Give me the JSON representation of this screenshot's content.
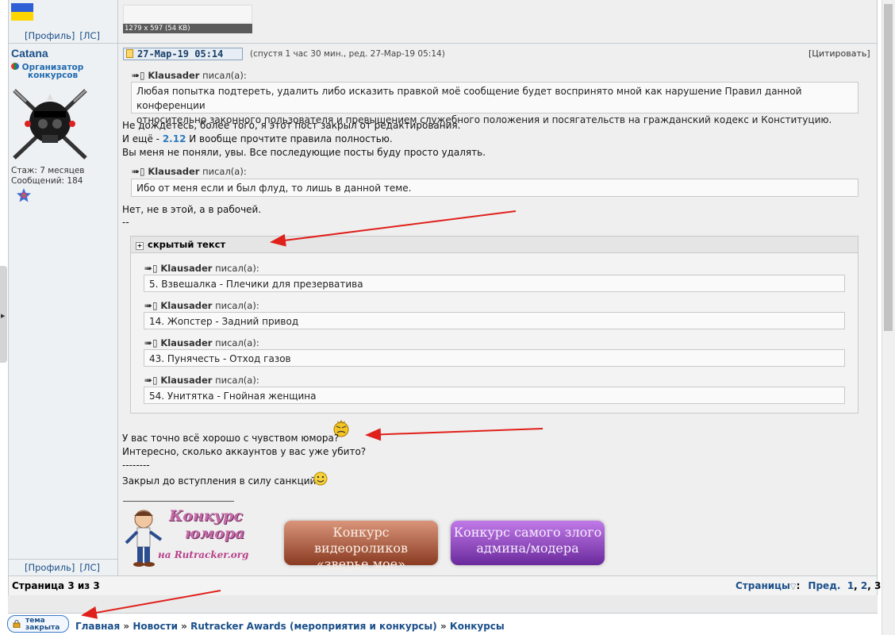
{
  "profile_links": {
    "profile": "[Профиль]",
    "pm": "[ЛС]"
  },
  "user": {
    "nick": "Catana",
    "rank_line1": "Организатор",
    "rank_line2": "конкурсов",
    "tenure": "Стаж: 7 месяцев",
    "posts": "Сообщений: 184"
  },
  "image_thumb": {
    "caption": "1279 x 597 (54 KB)"
  },
  "post": {
    "date": "27-Мар-19 05:14",
    "edited": "(спустя 1 час 30 мин., ред. 27-Мар-19 05:14)",
    "quote_button": "[Цитировать]",
    "quote1": {
      "author": "Klausader",
      "wrote": "писал(а):",
      "text_line1": "Любая попытка подтереть, удалить либо исказить правкой моё сообщение будет воспринято мной как нарушение Правил данной конференции",
      "text_line2": "относительно законного пользователя и превышением служебного положения и посягательств на гражданский кодекс и Конституцию."
    },
    "para1": "Не дождетесь, более того, я этот пост закрыл от редактирования.",
    "para2_pre": "И ещё - ",
    "para2_ref": "2.12",
    "para2_post": " И вообще прочтите правила полностью.",
    "para3": "Вы меня не поняли, увы. Все последующие посты буду просто удалять.",
    "quote2": {
      "author": "Klausader",
      "wrote": "писал(а):",
      "text": "Ибо от меня если и был флуд, то лишь в данной теме."
    },
    "para4": "Нет, не в этой, а в рабочей.",
    "para5": "--",
    "spoiler": {
      "title": "скрытый текст",
      "quotes": [
        {
          "author": "Klausader",
          "wrote": "писал(а):",
          "text": "5. Взвешалка - Плечики для презерватива"
        },
        {
          "author": "Klausader",
          "wrote": "писал(а):",
          "text": "14. Жопстер - Задний привод"
        },
        {
          "author": "Klausader",
          "wrote": "писал(а):",
          "text": "43. Пунячесть - Отход газов"
        },
        {
          "author": "Klausader",
          "wrote": "писал(а):",
          "text": "54. Унитятка - Гнойная женщина"
        }
      ]
    },
    "para6": "У вас точно всё хорошо с чувством юмора?",
    "para7": "Интересно, сколько аккаунтов у вас уже убито?",
    "para8": "--------",
    "para9": "Закрыл до вступления в силу санкций."
  },
  "signature": {
    "banner1_line1": "Конкурс",
    "banner1_line2": "юмора",
    "banner1_line3": "на Rutracker.org",
    "banner2_line1": "Конкурс видеороликов",
    "banner2_line2": "«зверье мое»",
    "banner3_line1": "Конкурс самого злого",
    "banner3_line2": "админа/модера"
  },
  "pagination": {
    "page_of": "Страница 3 из 3",
    "pages_label": "Страницы",
    "sep": ":",
    "prev": "Пред.",
    "p1": "1",
    "p2": "2",
    "p3": "3",
    "comma": ","
  },
  "topic_locked": {
    "line1": "тема",
    "line2": "закрыта"
  },
  "breadcrumbs": {
    "home": "Главная",
    "news": "Новости",
    "awards": "Rutracker Awards (мероприятия и конкурсы)",
    "contests": "Конкурсы",
    "sep": "»"
  },
  "colors": {
    "link": "#1b4f8a",
    "arrow": "#e0201b",
    "accent": "#2f7abf"
  }
}
